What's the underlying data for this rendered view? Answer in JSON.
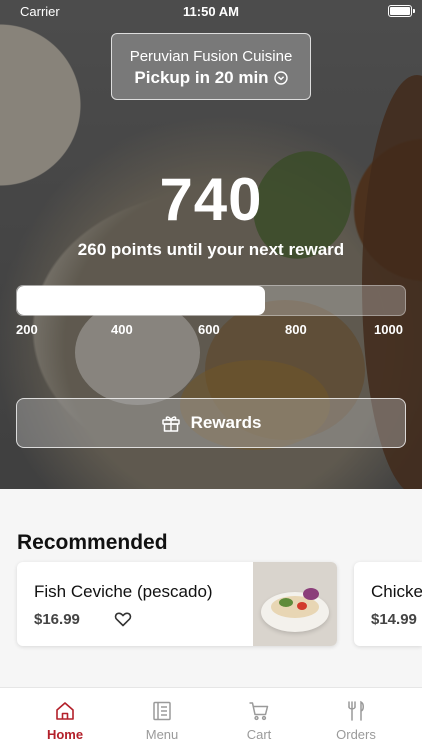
{
  "status_bar": {
    "carrier": "Carrier",
    "time": "11:50 AM"
  },
  "restaurant": {
    "name": "Peruvian Fusion Cuisine",
    "pickup": "Pickup in 20 min"
  },
  "rewards": {
    "points": "740",
    "subtitle": "260 points until your next reward",
    "progress_fraction": 0.64,
    "ticks": [
      "200",
      "400",
      "600",
      "800",
      "1000"
    ],
    "button_label": "Rewards"
  },
  "recommended": {
    "title": "Recommended",
    "items": [
      {
        "name": "Fish Ceviche (pescado)",
        "price": "$16.99"
      },
      {
        "name": "Chicke",
        "price": "$14.99"
      }
    ]
  },
  "tabs": [
    {
      "label": "Home",
      "icon": "home-icon",
      "active": true
    },
    {
      "label": "Menu",
      "icon": "menu-icon",
      "active": false
    },
    {
      "label": "Cart",
      "icon": "cart-icon",
      "active": false
    },
    {
      "label": "Orders",
      "icon": "fork-knife-icon",
      "active": false
    }
  ],
  "colors": {
    "accent": "#b3202a",
    "inactive": "#9a9a9a"
  }
}
